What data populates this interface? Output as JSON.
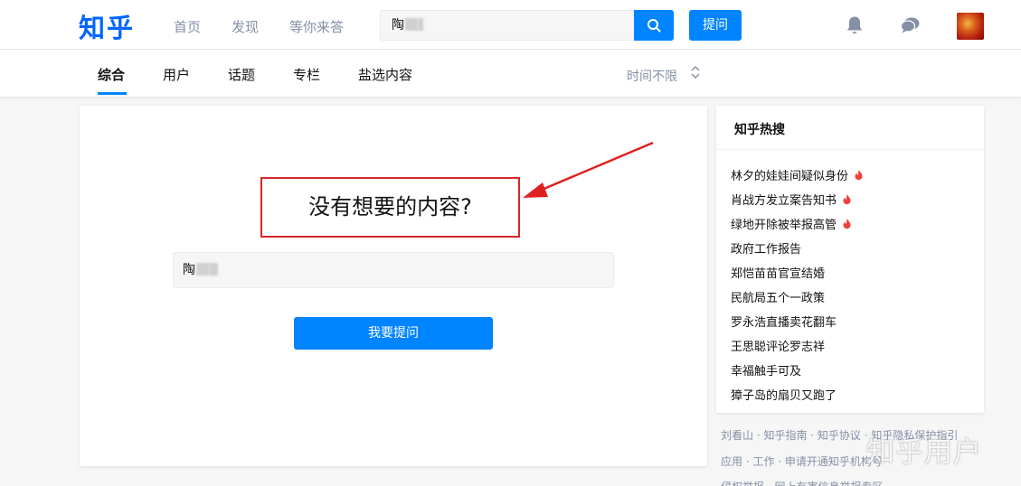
{
  "header": {
    "logo": "知乎",
    "nav": [
      "首页",
      "发现",
      "等你来答"
    ],
    "search_value": "陶",
    "ask_label": "提问"
  },
  "tabs": {
    "items": [
      "综合",
      "用户",
      "话题",
      "专栏",
      "盐选内容"
    ],
    "active": "综合",
    "time_filter": "时间不限"
  },
  "main": {
    "empty_title": "没有想要的内容?",
    "query_value": "陶",
    "ask_button": "我要提问"
  },
  "sidebar": {
    "title": "知乎热搜",
    "items": [
      {
        "label": "林夕的娃娃间疑似身份",
        "hot": true
      },
      {
        "label": "肖战方发立案告知书",
        "hot": true
      },
      {
        "label": "绿地开除被举报高管",
        "hot": true
      },
      {
        "label": "政府工作报告",
        "hot": false
      },
      {
        "label": "郑恺苗苗官宣结婚",
        "hot": false
      },
      {
        "label": "民航局五个一政策",
        "hot": false
      },
      {
        "label": "罗永浩直播卖花翻车",
        "hot": false
      },
      {
        "label": "王思聪评论罗志祥",
        "hot": false
      },
      {
        "label": "幸福触手可及",
        "hot": false
      },
      {
        "label": "獐子岛的扇贝又跑了",
        "hot": false
      }
    ]
  },
  "footer": {
    "line1": "刘看山 · 知乎指南 · 知乎协议 · 知乎隐私保护指引",
    "line2": "应用 · 工作 · 申请开通知乎机构号",
    "line3": "侵权举报 · 网上有害信息举报专区"
  },
  "watermark": "知乎用户",
  "colors": {
    "brand": "#0084ff",
    "logo": "#0066ff",
    "highlight_box": "#d9262b",
    "hot_fire": "#f1403c"
  }
}
